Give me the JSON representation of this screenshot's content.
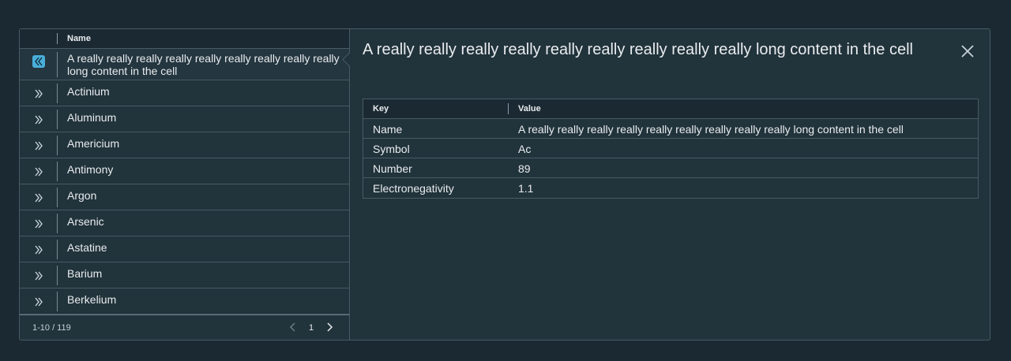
{
  "master": {
    "column_header": "Name",
    "rows": [
      {
        "name": "A really really really really really really really really really long content in the cell",
        "expanded": true
      },
      {
        "name": "Actinium",
        "expanded": false
      },
      {
        "name": "Aluminum",
        "expanded": false
      },
      {
        "name": "Americium",
        "expanded": false
      },
      {
        "name": "Antimony",
        "expanded": false
      },
      {
        "name": "Argon",
        "expanded": false
      },
      {
        "name": "Arsenic",
        "expanded": false
      },
      {
        "name": "Astatine",
        "expanded": false
      },
      {
        "name": "Barium",
        "expanded": false
      },
      {
        "name": "Berkelium",
        "expanded": false
      }
    ],
    "footer": {
      "range": "1-10 / 119",
      "page": "1"
    }
  },
  "detail": {
    "title": "A really really really really really really really really really long content in the cell",
    "table": {
      "key_header": "Key",
      "value_header": "Value",
      "rows": [
        {
          "key": "Name",
          "value": "A really really really really really really really really really long content in the cell"
        },
        {
          "key": "Symbol",
          "value": "Ac"
        },
        {
          "key": "Number",
          "value": "89"
        },
        {
          "key": "Electronegativity",
          "value": "1.1"
        }
      ]
    }
  },
  "icons": {
    "expand": "double-chevron-right-icon",
    "collapse": "double-chevron-left-icon",
    "prev": "chevron-left-icon",
    "next": "chevron-right-icon",
    "close": "close-icon"
  },
  "colors": {
    "background": "#1b2a32",
    "panel": "#21333b",
    "border": "#495a64",
    "accent": "#49afd9"
  }
}
